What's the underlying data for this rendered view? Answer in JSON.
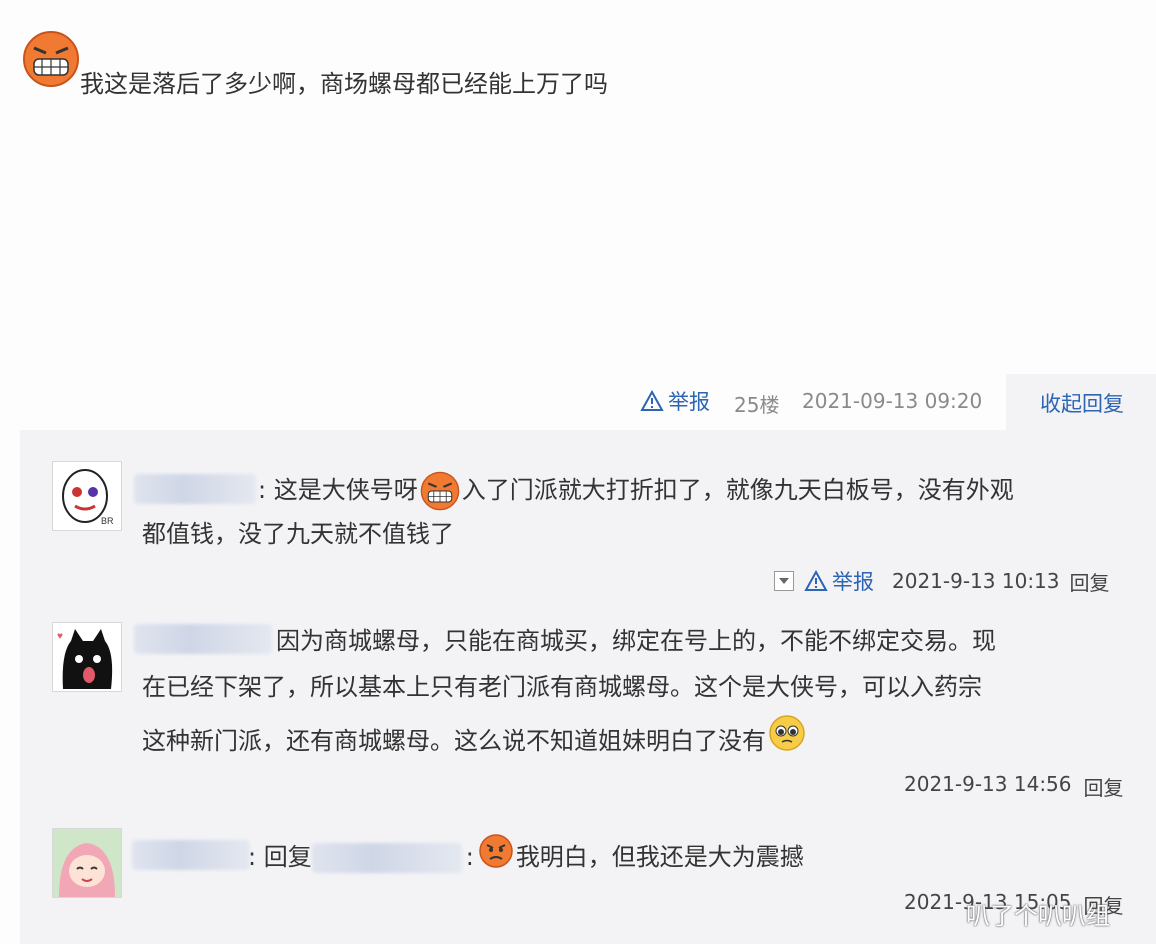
{
  "post": {
    "emoji_icon": "grinning-angry-face-icon",
    "text": "我这是落后了多少啊，商场螺母都已经能上万了吗",
    "report_label": "举报",
    "floor": "25楼",
    "timestamp": "2021-09-13 09:20",
    "collapse_label": "收起回复"
  },
  "replies": [
    {
      "avatar_icon": "masked-face-avatar",
      "separator": ": ",
      "line1": "这是大侠号呀",
      "line1b": "入了门派就大打折扣了，就像九天白板号，没有外观",
      "line2": "都值钱，没了九天就不值钱了",
      "report_label": "举报",
      "timestamp": "2021-9-13 10:13",
      "reply_label": "回复"
    },
    {
      "avatar_icon": "black-cat-avatar",
      "line1": "因为商城螺母，只能在商城买，绑定在号上的，不能不绑定交易。现",
      "line2": "在已经下架了，所以基本上只有老门派有商城螺母。这个是大侠号，可以入药宗",
      "line3": "这种新门派，还有商城螺母。这么说不知道姐妹明白了没有",
      "timestamp": "2021-9-13 14:56",
      "reply_label": "回复"
    },
    {
      "avatar_icon": "anime-girl-avatar",
      "separator": ": ",
      "reply_prefix": "回复",
      "separator2": ":",
      "text": "我明白，但我还是大为震撼",
      "timestamp": "2021-9-13 15:05",
      "reply_label": "回复"
    }
  ],
  "watermark": "叭了个叭叭组",
  "colors": {
    "link": "#2d64b3",
    "reply_bg": "#f3f3f6",
    "meta": "#8a8a8a"
  }
}
